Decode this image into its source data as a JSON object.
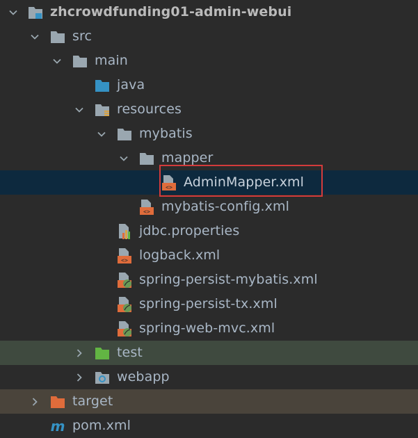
{
  "tree": {
    "root": "zhcrowdfunding01-admin-webui",
    "src": "src",
    "main": "main",
    "java": "java",
    "resources": "resources",
    "mybatis": "mybatis",
    "mapper": "mapper",
    "admin_mapper": "AdminMapper.xml",
    "mybatis_config": "mybatis-config.xml",
    "jdbc_properties": "jdbc.properties",
    "logback": "logback.xml",
    "spring_persist_mybatis": "spring-persist-mybatis.xml",
    "spring_persist_tx": "spring-persist-tx.xml",
    "spring_web_mvc": "spring-web-mvc.xml",
    "test": "test",
    "webapp": "webapp",
    "target": "target",
    "pom": "pom.xml"
  },
  "colors": {
    "background": "#2b2b2b",
    "selection": "#0d293e",
    "folder": "#9aa7b0",
    "java_folder": "#3592c4",
    "test_folder": "#62b543",
    "target_folder": "#e06c3b",
    "xml_badge": "#e06c3b",
    "spring_leaf": "#6a9955",
    "highlight_border": "#d43b3b"
  },
  "icons": {
    "expanded": "chevron-down-icon",
    "collapsed": "chevron-right-icon",
    "module": "module-folder-icon",
    "folder": "folder-icon",
    "source_folder": "source-folder-icon",
    "resources_folder": "resources-folder-icon",
    "xml": "xml-file-icon",
    "properties": "properties-file-icon",
    "spring_xml": "spring-xml-file-icon",
    "maven": "maven-icon"
  }
}
